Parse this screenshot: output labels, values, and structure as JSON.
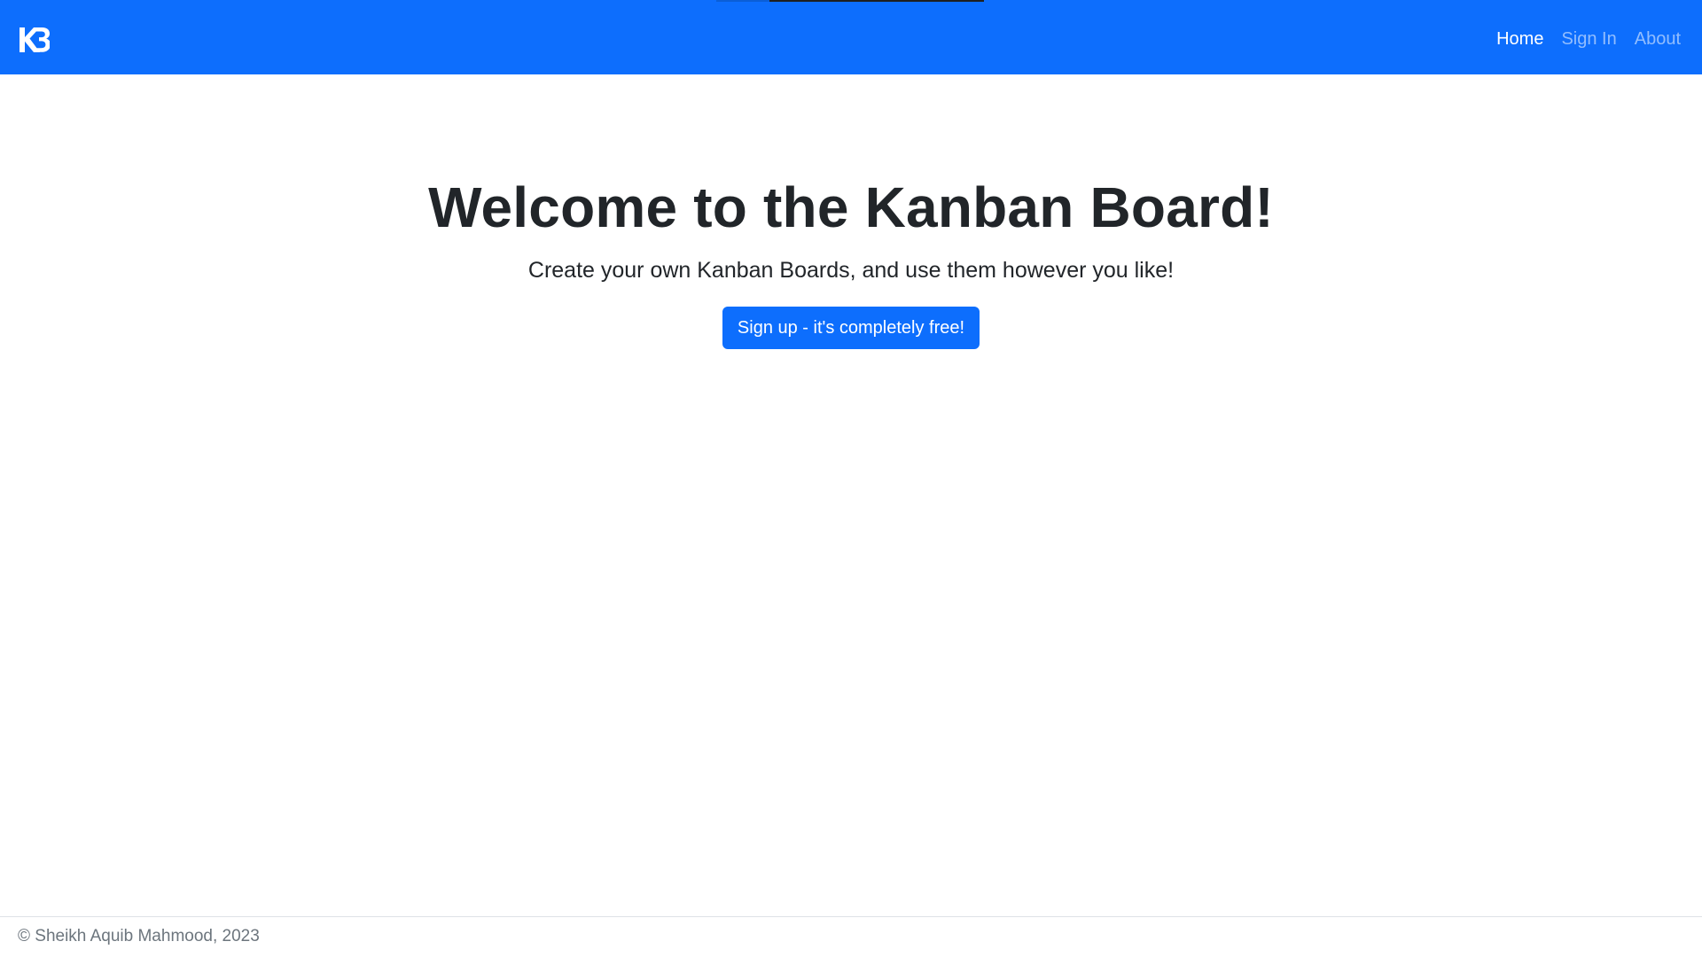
{
  "navbar": {
    "brand_label": "KB",
    "links": [
      {
        "label": "Home",
        "active": true
      },
      {
        "label": "Sign In",
        "active": false
      },
      {
        "label": "About",
        "active": false
      }
    ]
  },
  "hero": {
    "title": "Welcome to the Kanban Board!",
    "subtitle": "Create your own Kanban Boards, and use them however you like!",
    "cta_label": "Sign up - it's completely free!"
  },
  "footer": {
    "text": "© Sheikh Aquib Mahmood, 2023"
  },
  "colors": {
    "primary": "#0d6efd",
    "text": "#212529",
    "muted": "#6c757d"
  }
}
